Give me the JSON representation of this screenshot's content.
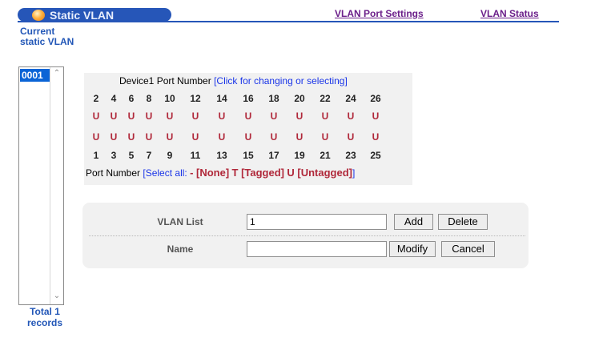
{
  "header": {
    "title": "Static VLAN",
    "links": [
      "VLAN Port Settings",
      "VLAN Status"
    ]
  },
  "sidebar": {
    "heading": "Current static VLAN",
    "items": [
      "0001"
    ],
    "total": "Total 1 records"
  },
  "port_panel": {
    "header_prefix": "Device1 Port Number",
    "header_link": "[Click for changing or selecting]",
    "even_ports": [
      "2",
      "4",
      "6",
      "8",
      "10",
      "12",
      "14",
      "16",
      "18",
      "20",
      "22",
      "24",
      "26"
    ],
    "even_states": [
      "U",
      "U",
      "U",
      "U",
      "U",
      "U",
      "U",
      "U",
      "U",
      "U",
      "U",
      "U",
      "U"
    ],
    "odd_states": [
      "U",
      "U",
      "U",
      "U",
      "U",
      "U",
      "U",
      "U",
      "U",
      "U",
      "U",
      "U",
      "U"
    ],
    "odd_ports": [
      "1",
      "3",
      "5",
      "7",
      "9",
      "11",
      "13",
      "15",
      "17",
      "19",
      "21",
      "23",
      "25"
    ],
    "legend": {
      "prefix": "Port Number",
      "select_all": "[Select all:",
      "none": "- [None]",
      "tagged": "T [Tagged]",
      "untagged": "U [Untagged]",
      "close": "]"
    }
  },
  "form": {
    "vlan_list_label": "VLAN List",
    "vlan_list_value": "1",
    "name_label": "Name",
    "name_value": "",
    "buttons": {
      "add": "Add",
      "delete": "Delete",
      "modify": "Modify",
      "cancel": "Cancel"
    }
  },
  "colors": {
    "accent_blue": "#2656b8",
    "link_purple": "#6b1f8a",
    "untagged_red": "#b0283a",
    "selected_item": "#0a64d6"
  }
}
